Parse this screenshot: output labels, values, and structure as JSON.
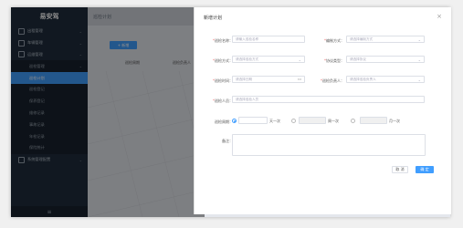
{
  "sidebar": {
    "logo": "易安驾",
    "items": [
      {
        "label": "出租管理",
        "type": "group"
      },
      {
        "label": "车辆管理",
        "type": "group"
      },
      {
        "label": "运维管理",
        "type": "group"
      },
      {
        "label": "巡检管理",
        "type": "sub"
      },
      {
        "label": "巡检计划",
        "type": "active"
      },
      {
        "label": "巡检登记",
        "type": "sub"
      },
      {
        "label": "保养登记",
        "type": "sub"
      },
      {
        "label": "维修记录",
        "type": "sub"
      },
      {
        "label": "事故记录",
        "type": "sub"
      },
      {
        "label": "年检记录",
        "type": "sub"
      },
      {
        "label": "保险统计",
        "type": "sub"
      },
      {
        "label": "系统管理配置",
        "type": "group"
      }
    ],
    "bottom_icon": "menu-icon"
  },
  "main": {
    "header_title": "巡检计划",
    "add_button": "+ 新增",
    "table_headers": [
      "巡检周期",
      "巡检负责人"
    ]
  },
  "dialog": {
    "title": "新增计划",
    "close": "×",
    "fields": {
      "plan_name": {
        "label": "巡检名称：",
        "placeholder": "请输入巡检名称"
      },
      "mode": {
        "label": "编制方式：",
        "placeholder": "请选择编制方式"
      },
      "plan_type": {
        "label": "巡检方式：",
        "placeholder": "请选择巡检方式"
      },
      "location": {
        "label": "协议类型：",
        "placeholder": "请选择协议"
      },
      "start_time": {
        "label": "巡检时间：",
        "placeholder": "请选择日期"
      },
      "responsible": {
        "label": "巡检负责人：",
        "placeholder": "请选择巡检负责人"
      },
      "inspector": {
        "label": "巡检人员：",
        "placeholder": "请选择巡检人员"
      },
      "cycle": {
        "label": "巡检周期：",
        "unit1": "天一次",
        "unit2": "周一次",
        "unit3": "月一次"
      },
      "remark": {
        "label": "备注："
      }
    },
    "cancel": "取 消",
    "confirm": "确 定"
  },
  "colors": {
    "accent": "#409eff",
    "sidebar": "#1f2d3d",
    "required": "#f56c6c"
  }
}
